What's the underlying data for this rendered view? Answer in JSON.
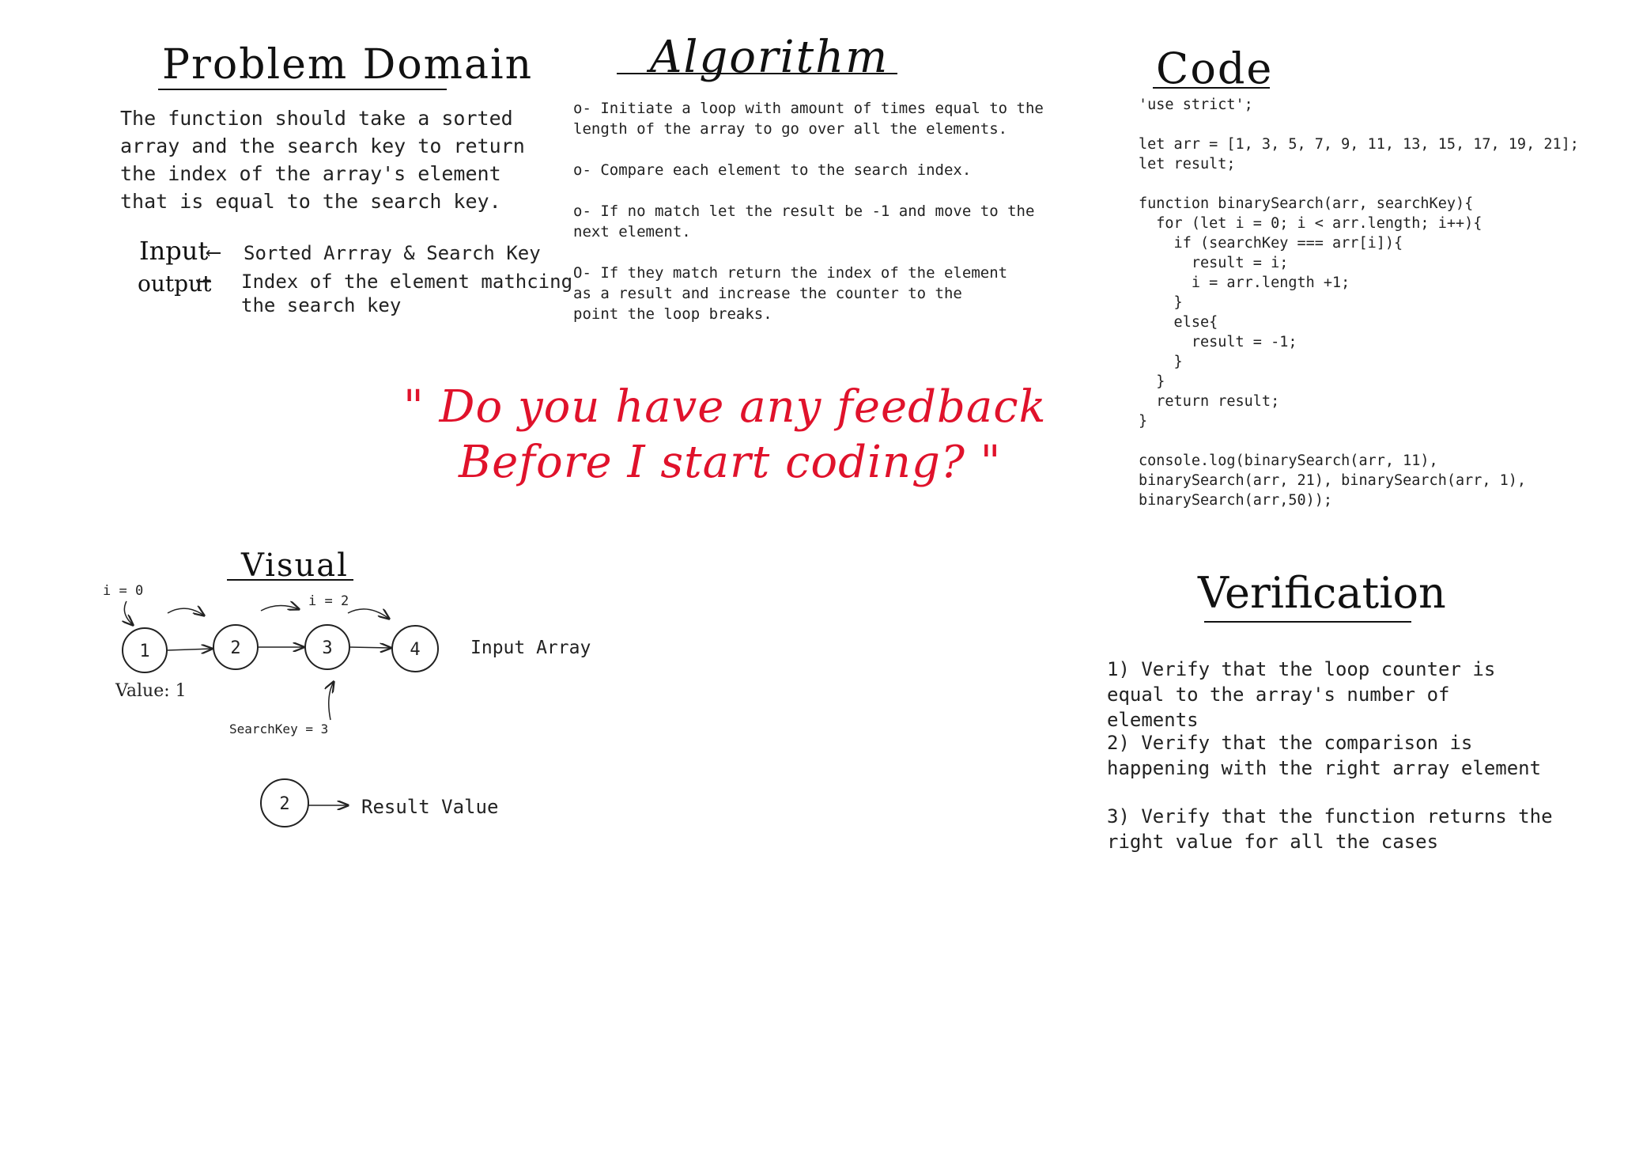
{
  "problem_domain": {
    "heading": "Problem Domain",
    "paragraph": "The function should take a sorted array and the search key to return the index of the array's element that is equal to the search key.",
    "input_label": "Input",
    "input_desc": "Sorted Arrray & Search Key",
    "output_label": "output",
    "output_desc_1": "Index of the element mathcing",
    "output_desc_2": "the search key"
  },
  "algorithm": {
    "heading": "Algorithm",
    "steps": [
      "o- Initiate a loop with amount of times equal to the length of the array to go over all the elements.",
      "o- Compare each element to the search index.",
      "o- If no match let the result be -1 and move to the next element.",
      "O- If they match return the index of the element as a result and increase the counter to the point the loop breaks."
    ]
  },
  "code": {
    "heading": "Code",
    "lines": [
      "'use strict';",
      "",
      "let arr = [1, 3, 5, 7, 9, 11, 13, 15, 17, 19, 21];",
      "let result;",
      "",
      "function binarySearch(arr, searchKey){",
      "  for (let i = 0; i < arr.length; i++){",
      "    if (searchKey === arr[i]){",
      "      result = i;",
      "      i = arr.length +1;",
      "    }",
      "    else{",
      "      result = -1;",
      "    }",
      "  }",
      "  return result;",
      "}",
      "",
      "console.log(binarySearch(arr, 11),",
      "binarySearch(arr, 21), binarySearch(arr, 1),",
      "binarySearch(arr,50));"
    ]
  },
  "feedback": {
    "line1": "\" Do you have any feedback",
    "line2": "Before I start coding? \""
  },
  "visual": {
    "heading": "Visual",
    "nodes": [
      "1",
      "2",
      "3",
      "4"
    ],
    "i0_label": "i = 0",
    "i2_label": "i = 2",
    "value_label": "Value: 1",
    "search_key_label": "SearchKey = 3",
    "input_array_label": "Input Array",
    "result_node": "2",
    "result_label": "Result Value"
  },
  "verification": {
    "heading": "Verification",
    "items": [
      "1) Verify that the loop counter is equal to the array's number of elements",
      "2) Verify that the comparison is happening with the right array element",
      "3) Verify that the function returns the right value for all the cases"
    ]
  },
  "colors": {
    "ink": "#222222",
    "accent_red": "#e0122b"
  }
}
